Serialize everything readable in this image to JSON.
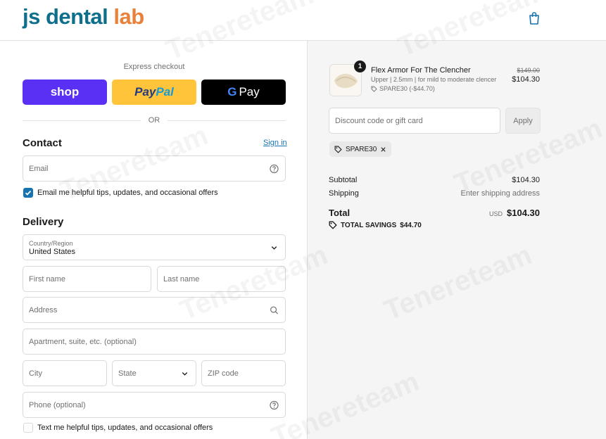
{
  "header": {
    "logo_main": "js dental ",
    "logo_accent": "lab",
    "cart_icon": "shopping-bag-icon",
    "brand_color": "#0e6f8c",
    "accent_color": "#e8823a"
  },
  "express": {
    "title": "Express checkout",
    "shop_label": "shop",
    "paypal_label_a": "Pay",
    "paypal_label_b": "Pal",
    "gpay_g": "G",
    "gpay_label": "Pay",
    "or_label": "OR"
  },
  "contact": {
    "heading": "Contact",
    "sign_in": "Sign in",
    "email_placeholder": "Email",
    "email_opt_in": "Email me helpful tips, updates, and occasional offers",
    "email_opt_in_checked": true
  },
  "delivery": {
    "heading": "Delivery",
    "country_label": "Country/Region",
    "country_value": "United States",
    "first_name_placeholder": "First name",
    "last_name_placeholder": "Last name",
    "address_placeholder": "Address",
    "apartment_placeholder": "Apartment, suite, etc. (optional)",
    "city_placeholder": "City",
    "state_placeholder": "State",
    "zip_placeholder": "ZIP code",
    "phone_placeholder": "Phone (optional)",
    "sms_opt_in": "Text me helpful tips, updates, and occasional offers",
    "sms_opt_in_checked": false
  },
  "summary": {
    "item": {
      "quantity": "1",
      "name": "Flex Armor For The Clencher",
      "variant": "Upper | 2.5mm | for mild to moderate clencer",
      "discount": "SPARE30 (-$44.70)",
      "price_original": "$149.00",
      "price": "$104.30"
    },
    "discount_placeholder": "Discount code or gift card",
    "apply_label": "Apply",
    "applied_code": "SPARE30",
    "subtotal_label": "Subtotal",
    "subtotal_value": "$104.30",
    "shipping_label": "Shipping",
    "shipping_value": "Enter shipping address",
    "total_label": "Total",
    "total_currency": "USD",
    "total_value": "$104.30",
    "savings_label": "TOTAL SAVINGS",
    "savings_value": "$44.70"
  },
  "watermark": "Tenereteam",
  "colors": {
    "shop_purple": "#5a31f4",
    "paypal_yellow": "#ffc439",
    "link_blue": "#1773b0",
    "summary_bg": "#f5f5f5"
  }
}
